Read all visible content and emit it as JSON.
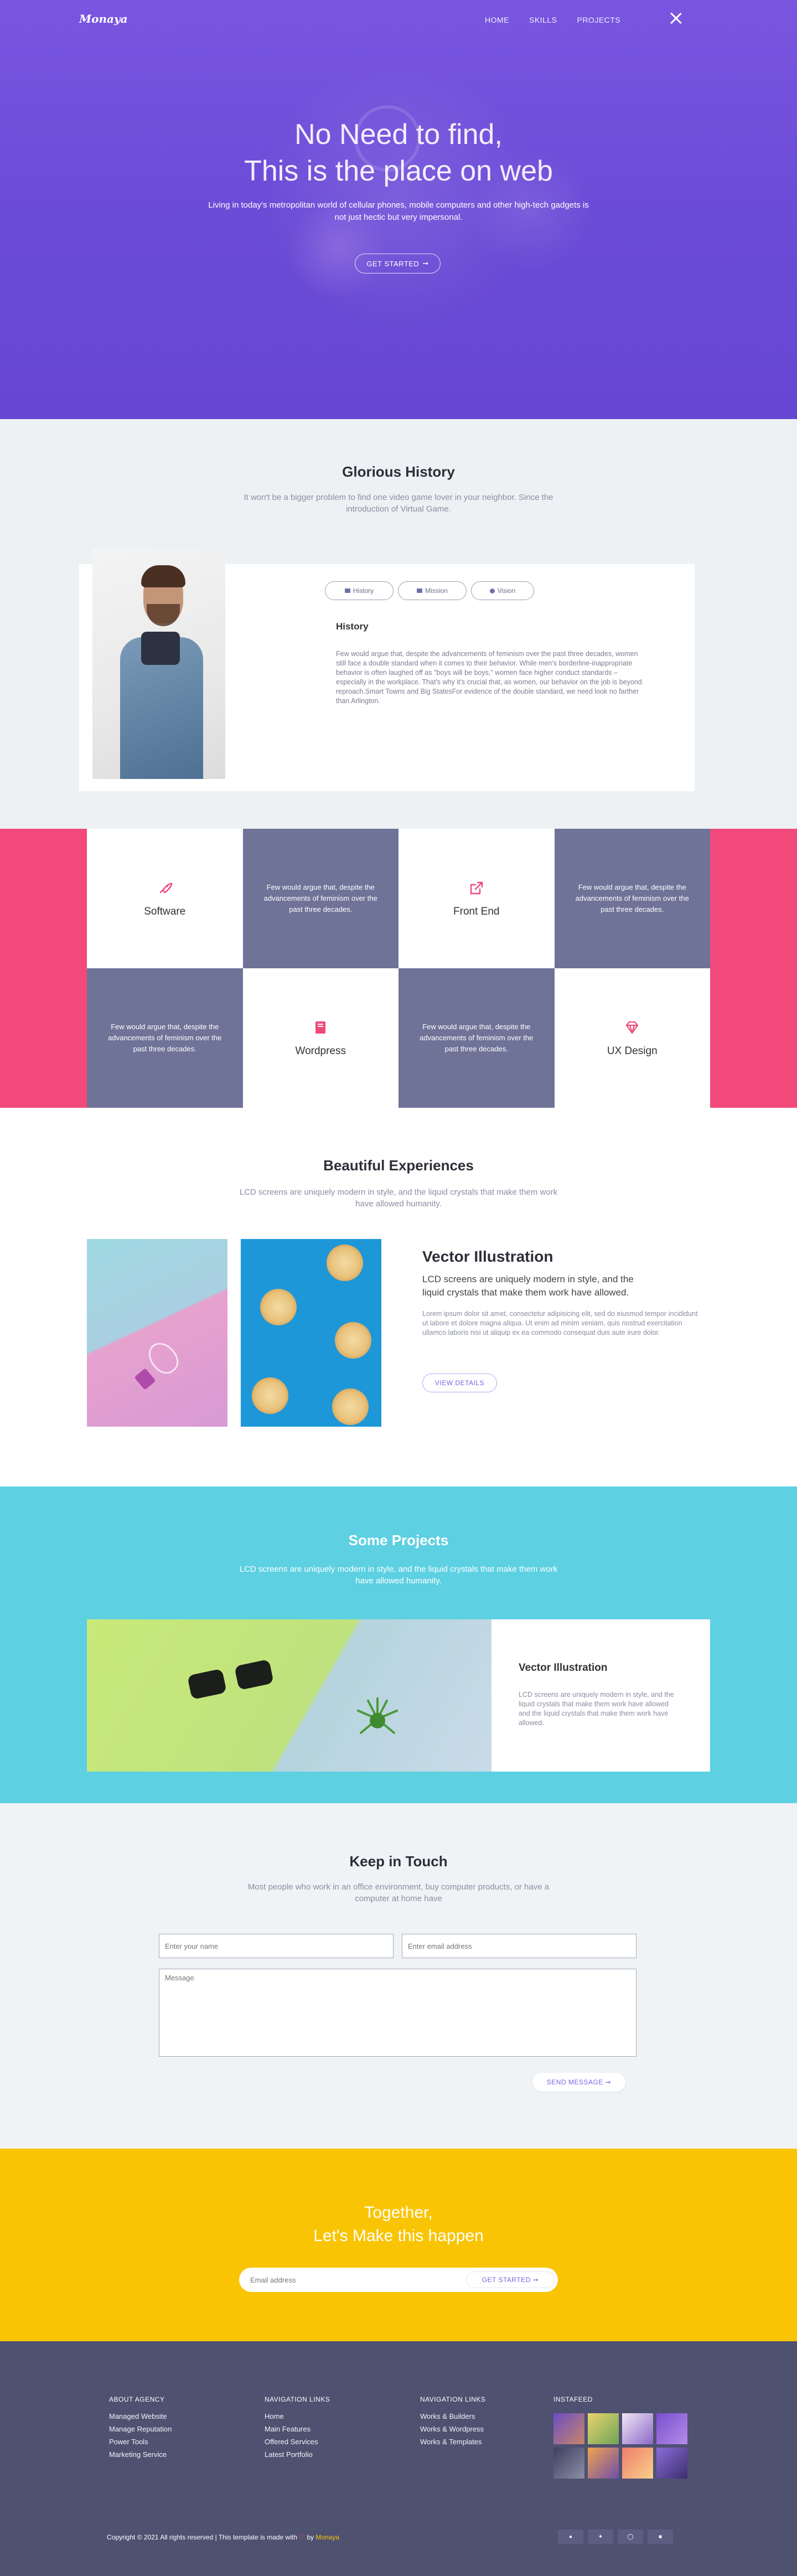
{
  "brand": {
    "name": "Monaya"
  },
  "nav": {
    "items": [
      "HOME",
      "SKILLS",
      "PROJECTS"
    ]
  },
  "hero": {
    "title_line1": "No Need to find,",
    "title_line2": "This is the place on web",
    "subtitle": "Living in today's metropolitan world of cellular phones, mobile computers and other high-tech gadgets is not just hectic but very impersonal.",
    "button": "GET STARTED"
  },
  "history": {
    "title": "Glorious History",
    "subtitle": "It won't be a bigger problem to find one video game lover in your neighbor. Since the introduction of Virtual Game.",
    "tabs": [
      "History",
      "Mission",
      "Vision"
    ],
    "heading": "History",
    "text": "Few would argue that, despite the advancements of feminism over the past three decades, women still face a double standard when it comes to their behavior. While men's borderline-inappropriate behavior is often laughed off as \"boys will be boys,\" women face higher conduct standards – especially in the workplace. That's why it's crucial that, as women, our behavior on the job is beyond reproach.Smart Towns and Big StatesFor evidence of the double standard, we need look no farther than Arlington."
  },
  "services": {
    "items": [
      {
        "label": "Software",
        "icon": "rocket-icon"
      },
      {
        "text": "Few would argue that, despite the advancements of feminism over the past three decades."
      },
      {
        "label": "Front End",
        "icon": "share-icon"
      },
      {
        "text": "Few would argue that, despite the advancements of feminism over the past three decades."
      },
      {
        "text": "Few would argue that, despite the advancements of feminism over the past three decades."
      },
      {
        "label": "Wordpress",
        "icon": "book-icon"
      },
      {
        "text": "Few would argue that, despite the advancements of feminism over the past three decades."
      },
      {
        "label": "UX Design",
        "icon": "diamond-icon"
      }
    ],
    "accent": "#f14a7a",
    "card_color": "#6f7398"
  },
  "experiences": {
    "title": "Beautiful Experiences",
    "subtitle": "LCD screens are uniquely modern in style, and the liquid crystals that make them work have allowed humanity.",
    "heading": "Vector Illustration",
    "lead": "LCD screens are uniquely modern in style, and the liquid crystals that make them work have allowed.",
    "text": "Lorem ipsum dolor sit amet, consectetur adipisicing elit, sed do eiusmod tempor incididunt ut labore et dolore magna aliqua. Ut enim ad minim veniam, quis nostrud exercitation ullamco laboris nisi ut aliquip ex ea commodo consequat duis aute irure dolor.",
    "button": "VIEW DETAILS"
  },
  "projects": {
    "title": "Some Projects",
    "subtitle": "LCD screens are uniquely modern in style, and the liquid crystals that make them work have allowed humanity.",
    "card_title": "Vector Illustration",
    "card_text": "LCD screens are uniquely modern in style, and the liquid crystals that make them work have allowed and the liquid crystals that make them work have allowed."
  },
  "contact": {
    "title": "Keep in Touch",
    "subtitle": "Most people who work in an office environment, buy computer products, or have a computer at home have",
    "name_placeholder": "Enter your name",
    "email_placeholder": "Enter email address",
    "message_placeholder": "Message",
    "button": "SEND MESSAGE"
  },
  "cta": {
    "title_line1": "Together,",
    "title_line2": "Let's Make this happen",
    "email_placeholder": "Email address",
    "button": "GET STARTED"
  },
  "footer": {
    "col1": {
      "heading": "ABOUT AGENCY",
      "links": [
        "Managed Website",
        "Manage Reputation",
        "Power Tools",
        "Marketing Service"
      ]
    },
    "col2": {
      "heading": "NAVIGATION LINKS",
      "links": [
        "Home",
        "Main Features",
        "Offered Services",
        "Latest Portfolio"
      ]
    },
    "col3": {
      "heading": "NAVIGATION LINKS",
      "links": [
        "Works & Builders",
        "Works & Wordpress",
        "Works & Templates"
      ]
    },
    "col4": {
      "heading": "INSTAFEED"
    },
    "copyright": "Copyright © 2021 All rights reserved | This template is made with",
    "copyright_by": "by",
    "copyright_author": "Monaya",
    "social": [
      "facebook-icon",
      "twitter-icon",
      "instagram-icon",
      "behance-icon"
    ]
  }
}
